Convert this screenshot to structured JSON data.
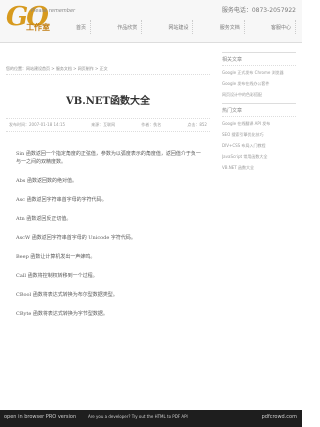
{
  "brand": {
    "logo_text": "GO",
    "slogan": "Please remember",
    "name": "工作室"
  },
  "header": {
    "phone": "服务电话：0873-2057922",
    "nav": [
      "首页",
      "作品欣赏",
      "网站建设",
      "服务文档",
      "客服中心"
    ]
  },
  "breadcrumb": "您的位置：网站建设首页 > 服务文档 > 网页制作 > 正文",
  "article": {
    "title": "VB.NET函数大全",
    "meta": [
      "发布时间：2007-01-18 14:15",
      "来源：互联网",
      "作者：佚名",
      "点击：852"
    ],
    "paragraphs": [
      "Sin 函数返回一个指定角度的正弦值，参数为以弧度表示的角度值，返回值介于负一与一之间的双精度数。",
      "Abs 函数返回数的绝对值。",
      "Asc 函数返回字符串首字母的字符代码。",
      "Atn 函数返回反正切值。",
      "AscW 函数返回字符串首字母的 Unicode 字符代码。",
      "Beep 函数让计算机发出一声蜂鸣。",
      "Call 函数将控制权转移到一个过程。",
      "CBool 函数将表达式转换为布尔型数据类型。",
      "CByte 函数将表达式转换为字节型数据。"
    ]
  },
  "sidebar": {
    "blocks": [
      {
        "heading": "相关文章",
        "items": [
          "Google 正式发布 Chrome 浏览器",
          "Google 发布在线办公套件",
          "网页设计中的色彩搭配"
        ]
      },
      {
        "heading": "热门文章",
        "items": [
          "Google 在线翻译 API 发布",
          "SEO 搜索引擎优化技巧",
          "DIV+CSS 布局入门教程",
          "JavaScript 常用函数大全",
          "VB.NET 函数大全"
        ]
      }
    ]
  },
  "footer": {
    "left": "open in browser  PRO version",
    "mid": "Are you a developer? Try out the HTML to PDF API",
    "right": "pdfcrowd.com"
  }
}
